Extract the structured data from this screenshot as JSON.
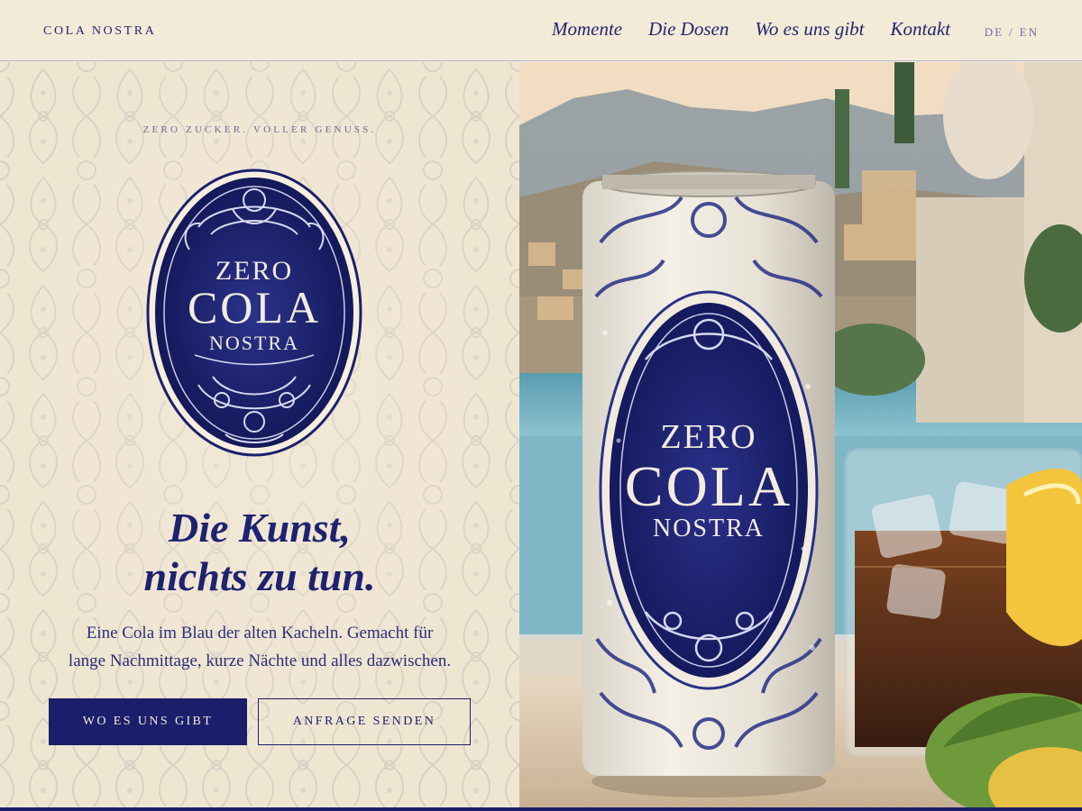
{
  "header": {
    "brand": "COLA NOSTRA",
    "nav": [
      "Momente",
      "Die Dosen",
      "Wo es uns gibt",
      "Kontakt"
    ],
    "lang": {
      "de": "DE",
      "separator": "/",
      "en": "EN"
    }
  },
  "hero": {
    "tagline": "ZERO ZUCKER. VOLLER GENUSS.",
    "headline_line1": "Die Kunst,",
    "headline_line2": "nichts zu tun.",
    "lead_line1": "Eine Cola im Blau der alten Kacheln. Gemacht für",
    "lead_line2": "lange Nachmittage, kurze Nächte und alles dazwischen.",
    "primary_cta": "WO ES UNS GIBT",
    "secondary_cta": "ANFRAGE SENDEN"
  },
  "logo": {
    "line1": "ZERO",
    "line2": "COLA",
    "line3": "NOSTRA"
  },
  "colors": {
    "navy": "#1b1f6b",
    "cream": "#f3ead8",
    "muted": "#6a6c9a"
  }
}
